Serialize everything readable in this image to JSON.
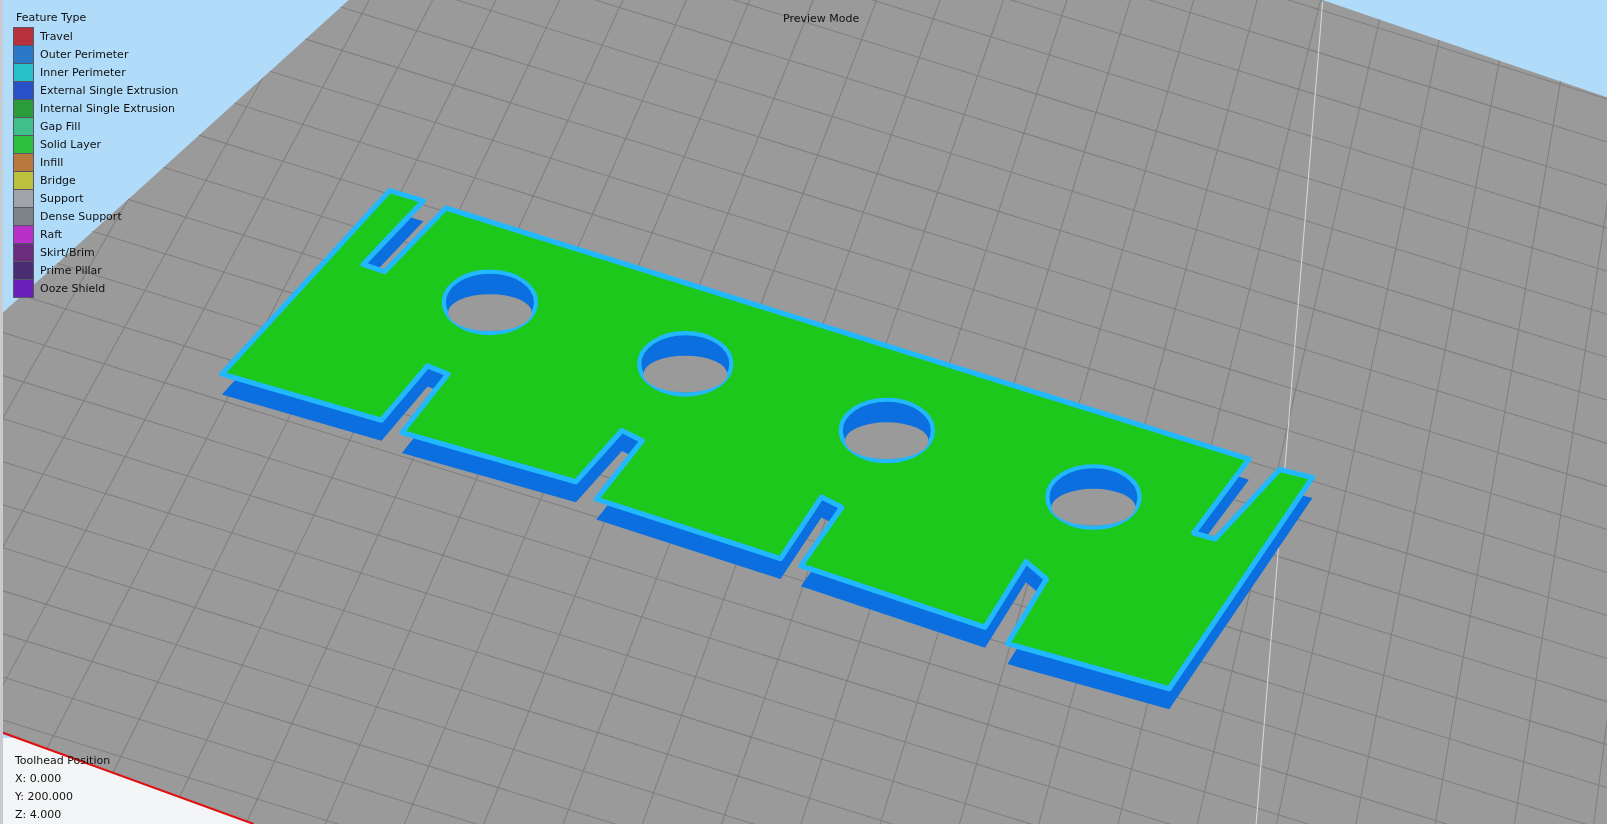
{
  "viewport": {
    "title": "Preview Mode"
  },
  "legend": {
    "title": "Feature Type",
    "items": [
      {
        "label": "Travel",
        "color": "#b8323c"
      },
      {
        "label": "Outer Perimeter",
        "color": "#2a78c8"
      },
      {
        "label": "Inner Perimeter",
        "color": "#28c0c8"
      },
      {
        "label": "External Single Extrusion",
        "color": "#2a50c8"
      },
      {
        "label": "Internal Single Extrusion",
        "color": "#2a9c3c"
      },
      {
        "label": "Gap Fill",
        "color": "#40c088"
      },
      {
        "label": "Solid Layer",
        "color": "#2cc03c"
      },
      {
        "label": "Infill",
        "color": "#b87a3c"
      },
      {
        "label": "Bridge",
        "color": "#bcc03c"
      },
      {
        "label": "Support",
        "color": "#a0a4a8"
      },
      {
        "label": "Dense Support",
        "color": "#7c8288"
      },
      {
        "label": "Raft",
        "color": "#b830c8"
      },
      {
        "label": "Skirt/Brim",
        "color": "#6a2c7c"
      },
      {
        "label": "Prime Pillar",
        "color": "#4a2c70"
      },
      {
        "label": "Ooze Shield",
        "color": "#6a20b8"
      }
    ]
  },
  "toolhead": {
    "title": "Toolhead Position",
    "lines": [
      "X: 0.000",
      "Y: 200.000",
      "Z: 4.000"
    ]
  }
}
